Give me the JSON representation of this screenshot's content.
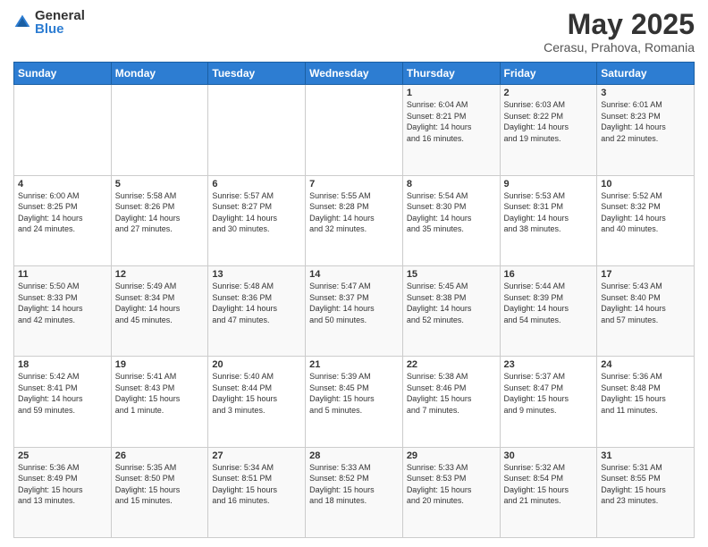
{
  "header": {
    "logo_general": "General",
    "logo_blue": "Blue",
    "title": "May 2025",
    "subtitle": "Cerasu, Prahova, Romania"
  },
  "weekdays": [
    "Sunday",
    "Monday",
    "Tuesday",
    "Wednesday",
    "Thursday",
    "Friday",
    "Saturday"
  ],
  "weeks": [
    [
      {
        "day": "",
        "info": ""
      },
      {
        "day": "",
        "info": ""
      },
      {
        "day": "",
        "info": ""
      },
      {
        "day": "",
        "info": ""
      },
      {
        "day": "1",
        "info": "Sunrise: 6:04 AM\nSunset: 8:21 PM\nDaylight: 14 hours\nand 16 minutes."
      },
      {
        "day": "2",
        "info": "Sunrise: 6:03 AM\nSunset: 8:22 PM\nDaylight: 14 hours\nand 19 minutes."
      },
      {
        "day": "3",
        "info": "Sunrise: 6:01 AM\nSunset: 8:23 PM\nDaylight: 14 hours\nand 22 minutes."
      }
    ],
    [
      {
        "day": "4",
        "info": "Sunrise: 6:00 AM\nSunset: 8:25 PM\nDaylight: 14 hours\nand 24 minutes."
      },
      {
        "day": "5",
        "info": "Sunrise: 5:58 AM\nSunset: 8:26 PM\nDaylight: 14 hours\nand 27 minutes."
      },
      {
        "day": "6",
        "info": "Sunrise: 5:57 AM\nSunset: 8:27 PM\nDaylight: 14 hours\nand 30 minutes."
      },
      {
        "day": "7",
        "info": "Sunrise: 5:55 AM\nSunset: 8:28 PM\nDaylight: 14 hours\nand 32 minutes."
      },
      {
        "day": "8",
        "info": "Sunrise: 5:54 AM\nSunset: 8:30 PM\nDaylight: 14 hours\nand 35 minutes."
      },
      {
        "day": "9",
        "info": "Sunrise: 5:53 AM\nSunset: 8:31 PM\nDaylight: 14 hours\nand 38 minutes."
      },
      {
        "day": "10",
        "info": "Sunrise: 5:52 AM\nSunset: 8:32 PM\nDaylight: 14 hours\nand 40 minutes."
      }
    ],
    [
      {
        "day": "11",
        "info": "Sunrise: 5:50 AM\nSunset: 8:33 PM\nDaylight: 14 hours\nand 42 minutes."
      },
      {
        "day": "12",
        "info": "Sunrise: 5:49 AM\nSunset: 8:34 PM\nDaylight: 14 hours\nand 45 minutes."
      },
      {
        "day": "13",
        "info": "Sunrise: 5:48 AM\nSunset: 8:36 PM\nDaylight: 14 hours\nand 47 minutes."
      },
      {
        "day": "14",
        "info": "Sunrise: 5:47 AM\nSunset: 8:37 PM\nDaylight: 14 hours\nand 50 minutes."
      },
      {
        "day": "15",
        "info": "Sunrise: 5:45 AM\nSunset: 8:38 PM\nDaylight: 14 hours\nand 52 minutes."
      },
      {
        "day": "16",
        "info": "Sunrise: 5:44 AM\nSunset: 8:39 PM\nDaylight: 14 hours\nand 54 minutes."
      },
      {
        "day": "17",
        "info": "Sunrise: 5:43 AM\nSunset: 8:40 PM\nDaylight: 14 hours\nand 57 minutes."
      }
    ],
    [
      {
        "day": "18",
        "info": "Sunrise: 5:42 AM\nSunset: 8:41 PM\nDaylight: 14 hours\nand 59 minutes."
      },
      {
        "day": "19",
        "info": "Sunrise: 5:41 AM\nSunset: 8:43 PM\nDaylight: 15 hours\nand 1 minute."
      },
      {
        "day": "20",
        "info": "Sunrise: 5:40 AM\nSunset: 8:44 PM\nDaylight: 15 hours\nand 3 minutes."
      },
      {
        "day": "21",
        "info": "Sunrise: 5:39 AM\nSunset: 8:45 PM\nDaylight: 15 hours\nand 5 minutes."
      },
      {
        "day": "22",
        "info": "Sunrise: 5:38 AM\nSunset: 8:46 PM\nDaylight: 15 hours\nand 7 minutes."
      },
      {
        "day": "23",
        "info": "Sunrise: 5:37 AM\nSunset: 8:47 PM\nDaylight: 15 hours\nand 9 minutes."
      },
      {
        "day": "24",
        "info": "Sunrise: 5:36 AM\nSunset: 8:48 PM\nDaylight: 15 hours\nand 11 minutes."
      }
    ],
    [
      {
        "day": "25",
        "info": "Sunrise: 5:36 AM\nSunset: 8:49 PM\nDaylight: 15 hours\nand 13 minutes."
      },
      {
        "day": "26",
        "info": "Sunrise: 5:35 AM\nSunset: 8:50 PM\nDaylight: 15 hours\nand 15 minutes."
      },
      {
        "day": "27",
        "info": "Sunrise: 5:34 AM\nSunset: 8:51 PM\nDaylight: 15 hours\nand 16 minutes."
      },
      {
        "day": "28",
        "info": "Sunrise: 5:33 AM\nSunset: 8:52 PM\nDaylight: 15 hours\nand 18 minutes."
      },
      {
        "day": "29",
        "info": "Sunrise: 5:33 AM\nSunset: 8:53 PM\nDaylight: 15 hours\nand 20 minutes."
      },
      {
        "day": "30",
        "info": "Sunrise: 5:32 AM\nSunset: 8:54 PM\nDaylight: 15 hours\nand 21 minutes."
      },
      {
        "day": "31",
        "info": "Sunrise: 5:31 AM\nSunset: 8:55 PM\nDaylight: 15 hours\nand 23 minutes."
      }
    ]
  ]
}
